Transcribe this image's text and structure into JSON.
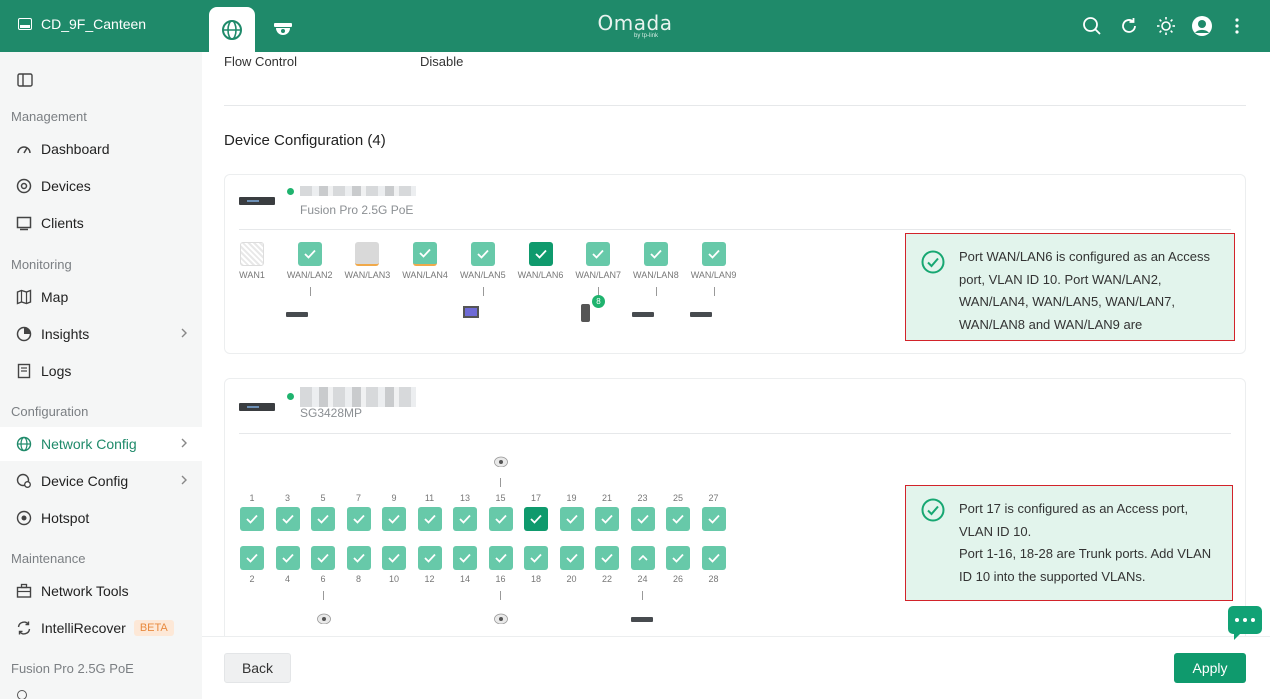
{
  "topbar": {
    "site_name": "CD_9F_Canteen",
    "logo_text": "Omada",
    "logo_sub": "by tp-link",
    "icons": [
      "search-icon",
      "refresh-icon",
      "theme-sun-icon",
      "user-avatar",
      "more-vertical-icon"
    ]
  },
  "sidebar": {
    "sections": {
      "management": "Management",
      "monitoring": "Monitoring",
      "configuration": "Configuration",
      "maintenance": "Maintenance",
      "device": "Fusion Pro 2.5G PoE"
    },
    "items": {
      "dashboard": "Dashboard",
      "devices": "Devices",
      "clients": "Clients",
      "map": "Map",
      "insights": "Insights",
      "logs": "Logs",
      "network_config": "Network Config",
      "device_config": "Device Config",
      "hotspot": "Hotspot",
      "network_tools": "Network Tools",
      "intellirecover": "IntelliRecover",
      "beta": "BETA"
    }
  },
  "main": {
    "flow_control_label": "Flow Control",
    "flow_control_value": "Disable",
    "section_title": "Device Configuration (4)",
    "gateway": {
      "model": "Fusion Pro 2.5G PoE",
      "ports": [
        {
          "label": "WAN1",
          "state": "unused"
        },
        {
          "label": "WAN/LAN2",
          "state": "trunk"
        },
        {
          "label": "WAN/LAN3",
          "state": "disconnected"
        },
        {
          "label": "WAN/LAN4",
          "state": "trunk"
        },
        {
          "label": "WAN/LAN5",
          "state": "trunk"
        },
        {
          "label": "WAN/LAN6",
          "state": "access"
        },
        {
          "label": "WAN/LAN7",
          "state": "trunk"
        },
        {
          "label": "WAN/LAN8",
          "state": "trunk"
        },
        {
          "label": "WAN/LAN9",
          "state": "trunk"
        }
      ],
      "client_badge": "8",
      "notice": "Port WAN/LAN6 is configured as an Access port, VLAN ID 10. Port WAN/LAN2, WAN/LAN4, WAN/LAN5, WAN/LAN7, WAN/LAN8 and WAN/LAN9 are"
    },
    "switch": {
      "model": "SG3428MP",
      "top_ports": [
        "1",
        "3",
        "5",
        "7",
        "9",
        "11",
        "13",
        "15",
        "17",
        "19",
        "21",
        "23",
        "25",
        "27"
      ],
      "bottom_ports": [
        "2",
        "4",
        "6",
        "8",
        "10",
        "12",
        "14",
        "16",
        "18",
        "20",
        "22",
        "24",
        "26",
        "28"
      ],
      "access_port": "17",
      "notice_line1": "Port 17 is configured as an Access port, VLAN ID 10.",
      "notice_line2": "Port 1-16, 18-28 are Trunk ports. Add VLAN ID 10 into the supported VLANs."
    }
  },
  "footer": {
    "back": "Back",
    "apply": "Apply"
  },
  "colors": {
    "brand": "#1f8a6a",
    "port_trunk": "#67c9a9",
    "port_access": "#0f9a6d",
    "notice_bg": "#e2f4ec",
    "highlight_border": "#d2232a"
  }
}
